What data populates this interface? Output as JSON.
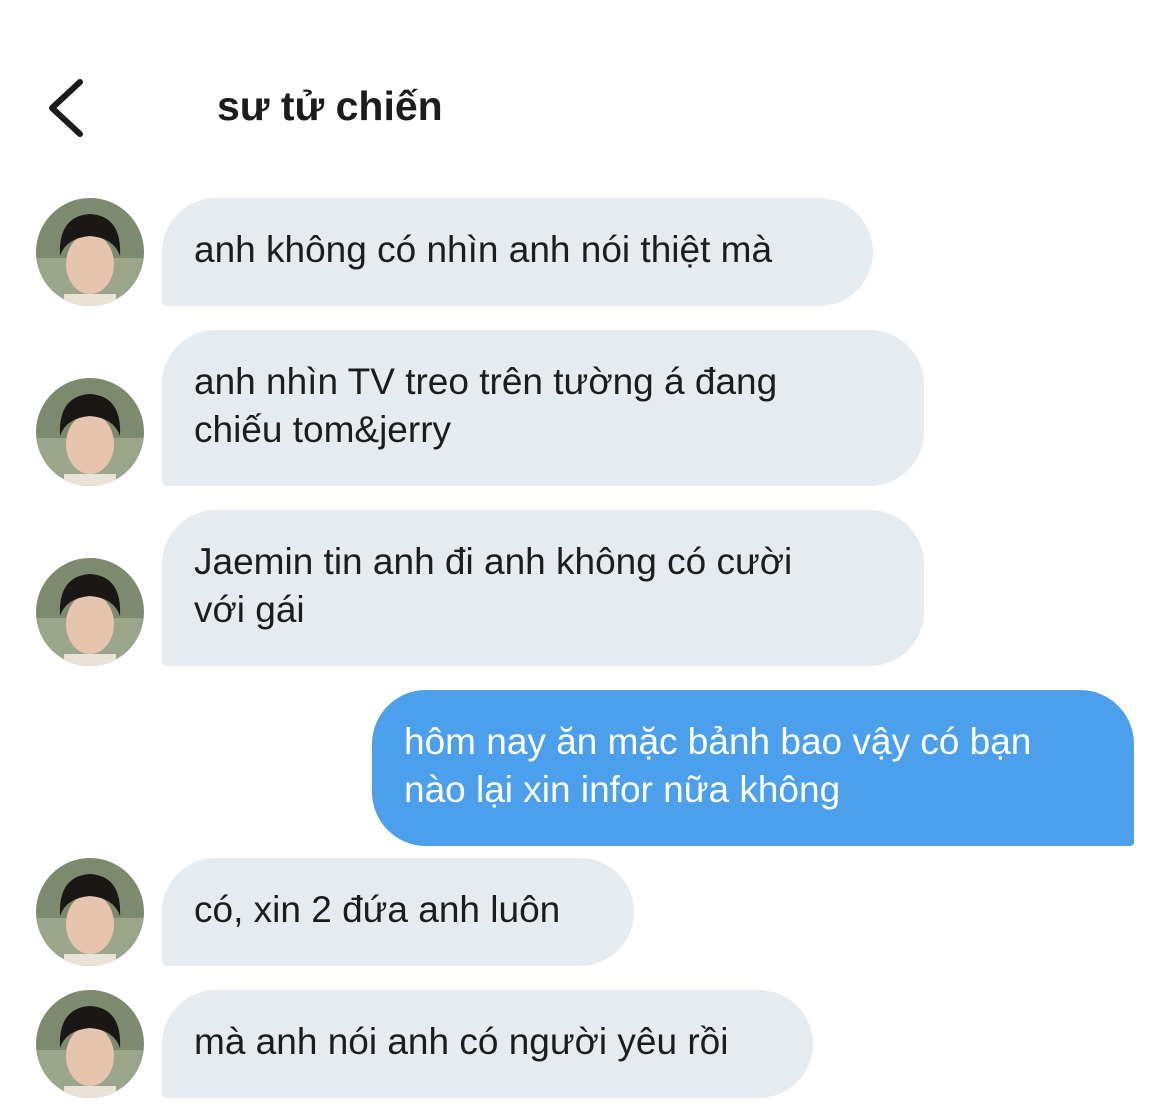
{
  "header": {
    "title": "sư tử chiến",
    "back_icon": "chevron-left-icon"
  },
  "colors": {
    "incoming_bubble": "#e6ebf0",
    "outgoing_bubble": "#4c9fea",
    "background": "#ffffff"
  },
  "messages": [
    {
      "direction": "incoming",
      "lines": [
        "anh không có nhìn anh nói thiệt mà"
      ]
    },
    {
      "direction": "incoming",
      "lines": [
        "anh nhìn TV treo trên tường á đang",
        "chiếu tom&jerry"
      ]
    },
    {
      "direction": "incoming",
      "lines": [
        "Jaemin tin anh đi anh không có cười",
        "với gái"
      ]
    },
    {
      "direction": "outgoing",
      "lines": [
        "hôm nay ăn mặc bảnh bao vậy có bạn",
        "nào lại xin infor nữa không"
      ]
    },
    {
      "direction": "incoming",
      "lines": [
        "có, xin 2 đứa anh luôn"
      ]
    },
    {
      "direction": "incoming",
      "lines": [
        "mà anh nói anh có người yêu rồi"
      ]
    }
  ]
}
